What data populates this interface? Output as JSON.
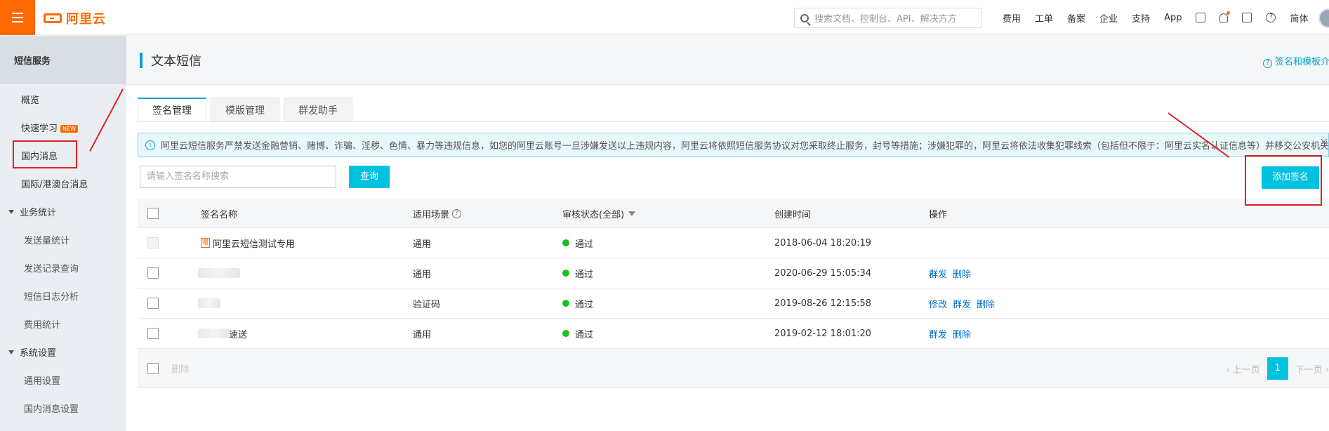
{
  "topbar": {
    "logo_text": "阿里云",
    "search_placeholder": "搜索文档、控制台、API、解决方方",
    "links": [
      "费用",
      "工单",
      "备案",
      "企业",
      "支持",
      "App"
    ],
    "lang": "简体"
  },
  "sidebar": {
    "title": "短信服务",
    "items": [
      {
        "label": "概览"
      },
      {
        "label": "快速学习",
        "badge": "NEW"
      },
      {
        "label": "国内消息"
      },
      {
        "label": "国际/港澳台消息"
      }
    ],
    "groups": [
      {
        "label": "业务统计",
        "children": [
          "发送量统计",
          "发送记录查询",
          "短信日志分析",
          "费用统计"
        ]
      },
      {
        "label": "系统设置",
        "children": [
          "通用设置",
          "国内消息设置"
        ]
      }
    ]
  },
  "main": {
    "title": "文本短信",
    "help_link": "签名和模板介绍",
    "tabs": [
      "签名管理",
      "模版管理",
      "群发助手"
    ],
    "notice": "阿里云短信服务严禁发送金融营销、赌博、诈骗、淫秽、色情、暴力等违规信息，如您的阿里云账号一旦涉嫌发送以上违规内容，阿里云将依照短信服务协议对您采取终止服务，封号等措施；涉嫌犯罪的，阿里云将依法收集犯罪线索（包括但不限于：阿里云实名认证信息等）并移交公安机关处理。",
    "search_placeholder": "请输入签名名称搜索",
    "query_button": "查询",
    "add_button": "添加签名",
    "table": {
      "columns": [
        "签名名称",
        "适用场景",
        "审核状态(全部)",
        "创建时间",
        "操作"
      ],
      "rows": [
        {
          "tag": "赠",
          "name": "阿里云短信测试专用",
          "scene": "通用",
          "status": "通过",
          "created": "2018-06-04 18:20:19",
          "actions": []
        },
        {
          "name": "",
          "scene": "通用",
          "status": "通过",
          "created": "2020-06-29 15:05:34",
          "actions": [
            "群发",
            "删除"
          ]
        },
        {
          "name": "",
          "scene": "验证码",
          "status": "通过",
          "created": "2019-08-26 12:15:58",
          "actions": [
            "修改",
            "群发",
            "删除"
          ]
        },
        {
          "name": "速送",
          "scene": "通用",
          "status": "通过",
          "created": "2019-02-12 18:01:20",
          "actions": [
            "群发",
            "删除"
          ]
        }
      ],
      "footer_delete": "删除",
      "pager": {
        "prev": "上一页",
        "page": "1",
        "next": "下一页"
      }
    }
  }
}
